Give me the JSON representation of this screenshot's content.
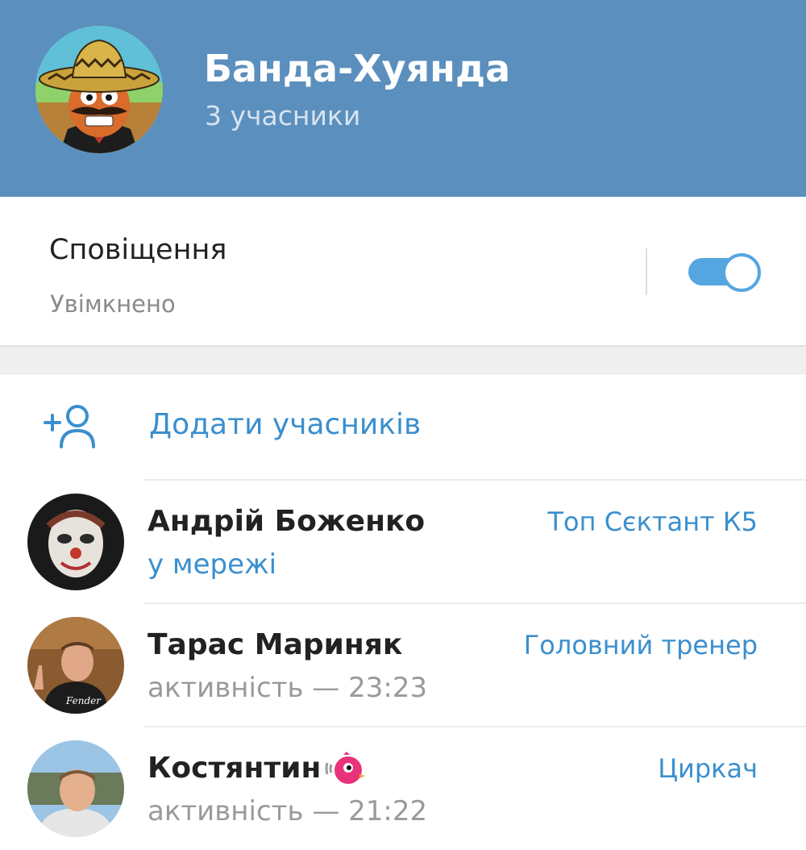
{
  "header": {
    "title": "Банда-Хуянда",
    "subtitle": "3 учасники",
    "avatar_icon": "sombrero-mustache-avatar",
    "background_color": "#5b8fbd"
  },
  "notifications": {
    "label": "Сповіщення",
    "status": "Увімкнено",
    "enabled": true,
    "toggle_color": "#55a6e0"
  },
  "add_members": {
    "icon": "add-user-icon",
    "label": "Додати учасників"
  },
  "members": [
    {
      "name": "Андрій Боженко",
      "status": "у мережі",
      "online": true,
      "role": "Топ Сєктант К5",
      "avatar_icon": "clown-avatar"
    },
    {
      "name": "Тарас Мариняк",
      "status": "активність — 23:23",
      "online": false,
      "role": "Головний тренер",
      "avatar_icon": "photo-avatar"
    },
    {
      "name": "Костянтин",
      "status": "активність — 21:22",
      "online": false,
      "role": "Циркач",
      "avatar_icon": "photo-avatar",
      "emoji_status_icon": "pink-bird-emoji"
    }
  ],
  "colors": {
    "accent": "#3a8fce",
    "muted_text": "#9a9a9a",
    "separator": "#efefef"
  }
}
